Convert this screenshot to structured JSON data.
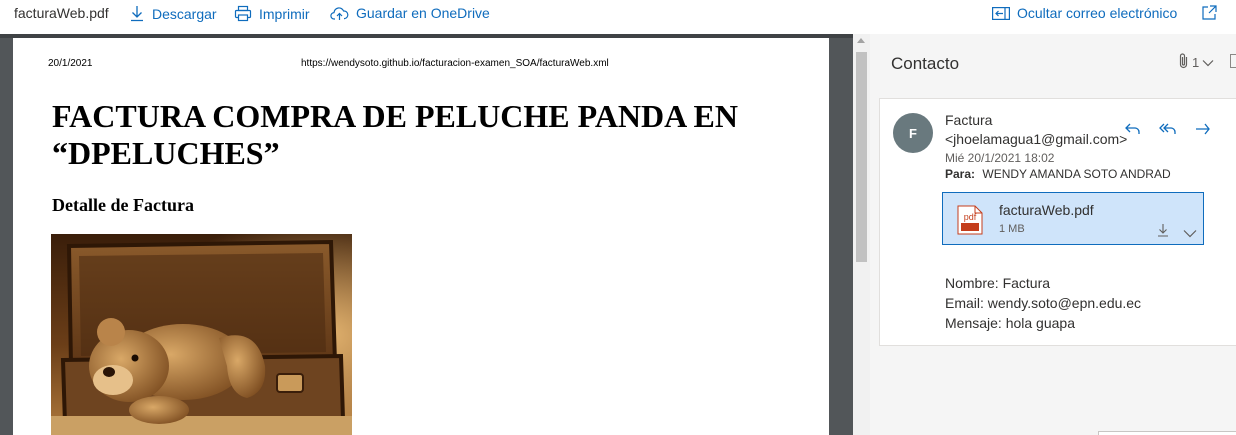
{
  "toolbar": {
    "file_name": "facturaWeb.pdf",
    "download_label": "Descargar",
    "print_label": "Imprimir",
    "onedrive_label": "Guardar en OneDrive",
    "hide_email_label": "Ocultar correo electrónico"
  },
  "pdf": {
    "header_date": "20/1/2021",
    "header_url": "https://wendysoto.github.io/facturacion-examen_SOA/facturaWeb.xml",
    "title": "FACTURA COMPRA DE PELUCHE PANDA EN “DPELUCHES”",
    "subtitle": "Detalle de Factura"
  },
  "pane": {
    "title": "Contacto",
    "attachment_count": "1",
    "message": {
      "avatar_initial": "F",
      "sender": "Factura <jhoelamagua1@gmail.com>",
      "date": "Mié 20/1/2021 18:02",
      "to_label": "Para:",
      "to_value": "WENDY AMANDA SOTO ANDRAD",
      "attachment": {
        "name": "facturaWeb.pdf",
        "size": "1 MB",
        "icon_text": "pdf"
      },
      "body": {
        "line1": "Nombre: Factura",
        "line2": "Email: wendy.soto@epn.edu.ec",
        "line3": "Mensaje: hola guapa"
      }
    }
  },
  "colors": {
    "accent": "#0f6cbd",
    "viewer_bg": "#525659",
    "attachment_bg": "#cfe4fa",
    "avatar_bg": "#69797e"
  },
  "icons": [
    "download-icon",
    "print-icon",
    "cloud-upload-icon",
    "hide-email-icon",
    "pop-out-icon",
    "paperclip-icon",
    "reply-icon",
    "reply-all-icon",
    "forward-icon",
    "pdf-file-icon",
    "chevron-down-icon"
  ]
}
